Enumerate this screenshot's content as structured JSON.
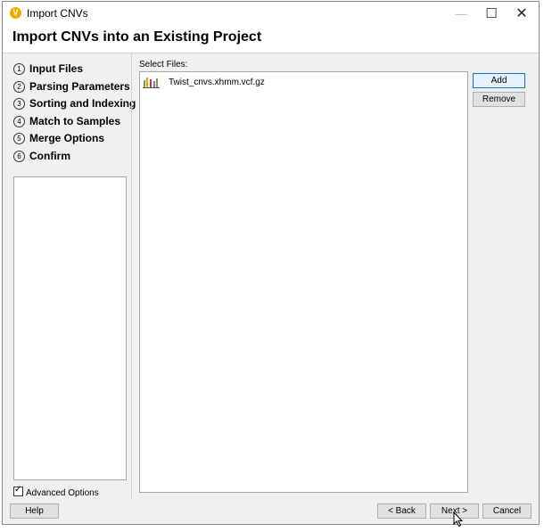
{
  "window": {
    "title": "Import CNVs",
    "heading": "Import CNVs into an Existing Project",
    "controls": {
      "minimize": "—",
      "maximize": "☐",
      "close": "✕"
    }
  },
  "wizard": {
    "steps": [
      {
        "num": "1",
        "label": "Input Files"
      },
      {
        "num": "2",
        "label": "Parsing Parameters"
      },
      {
        "num": "3",
        "label": "Sorting and Indexing"
      },
      {
        "num": "4",
        "label": "Match to Samples"
      },
      {
        "num": "5",
        "label": "Merge Options"
      },
      {
        "num": "6",
        "label": "Confirm"
      }
    ],
    "advanced_options": {
      "label": "Advanced Options",
      "checked": true
    }
  },
  "files": {
    "label": "Select Files:",
    "items": [
      {
        "name": "Twist_cnvs.xhmm.vcf.gz",
        "icon": "vcf-file-icon"
      }
    ],
    "add_label": "Add",
    "remove_label": "Remove"
  },
  "footer": {
    "help_label": "Help",
    "back_label": "< Back",
    "next_label": "Next >",
    "cancel_label": "Cancel"
  },
  "colors": {
    "accent": "#0078d7",
    "app_icon": "#f2a900"
  }
}
